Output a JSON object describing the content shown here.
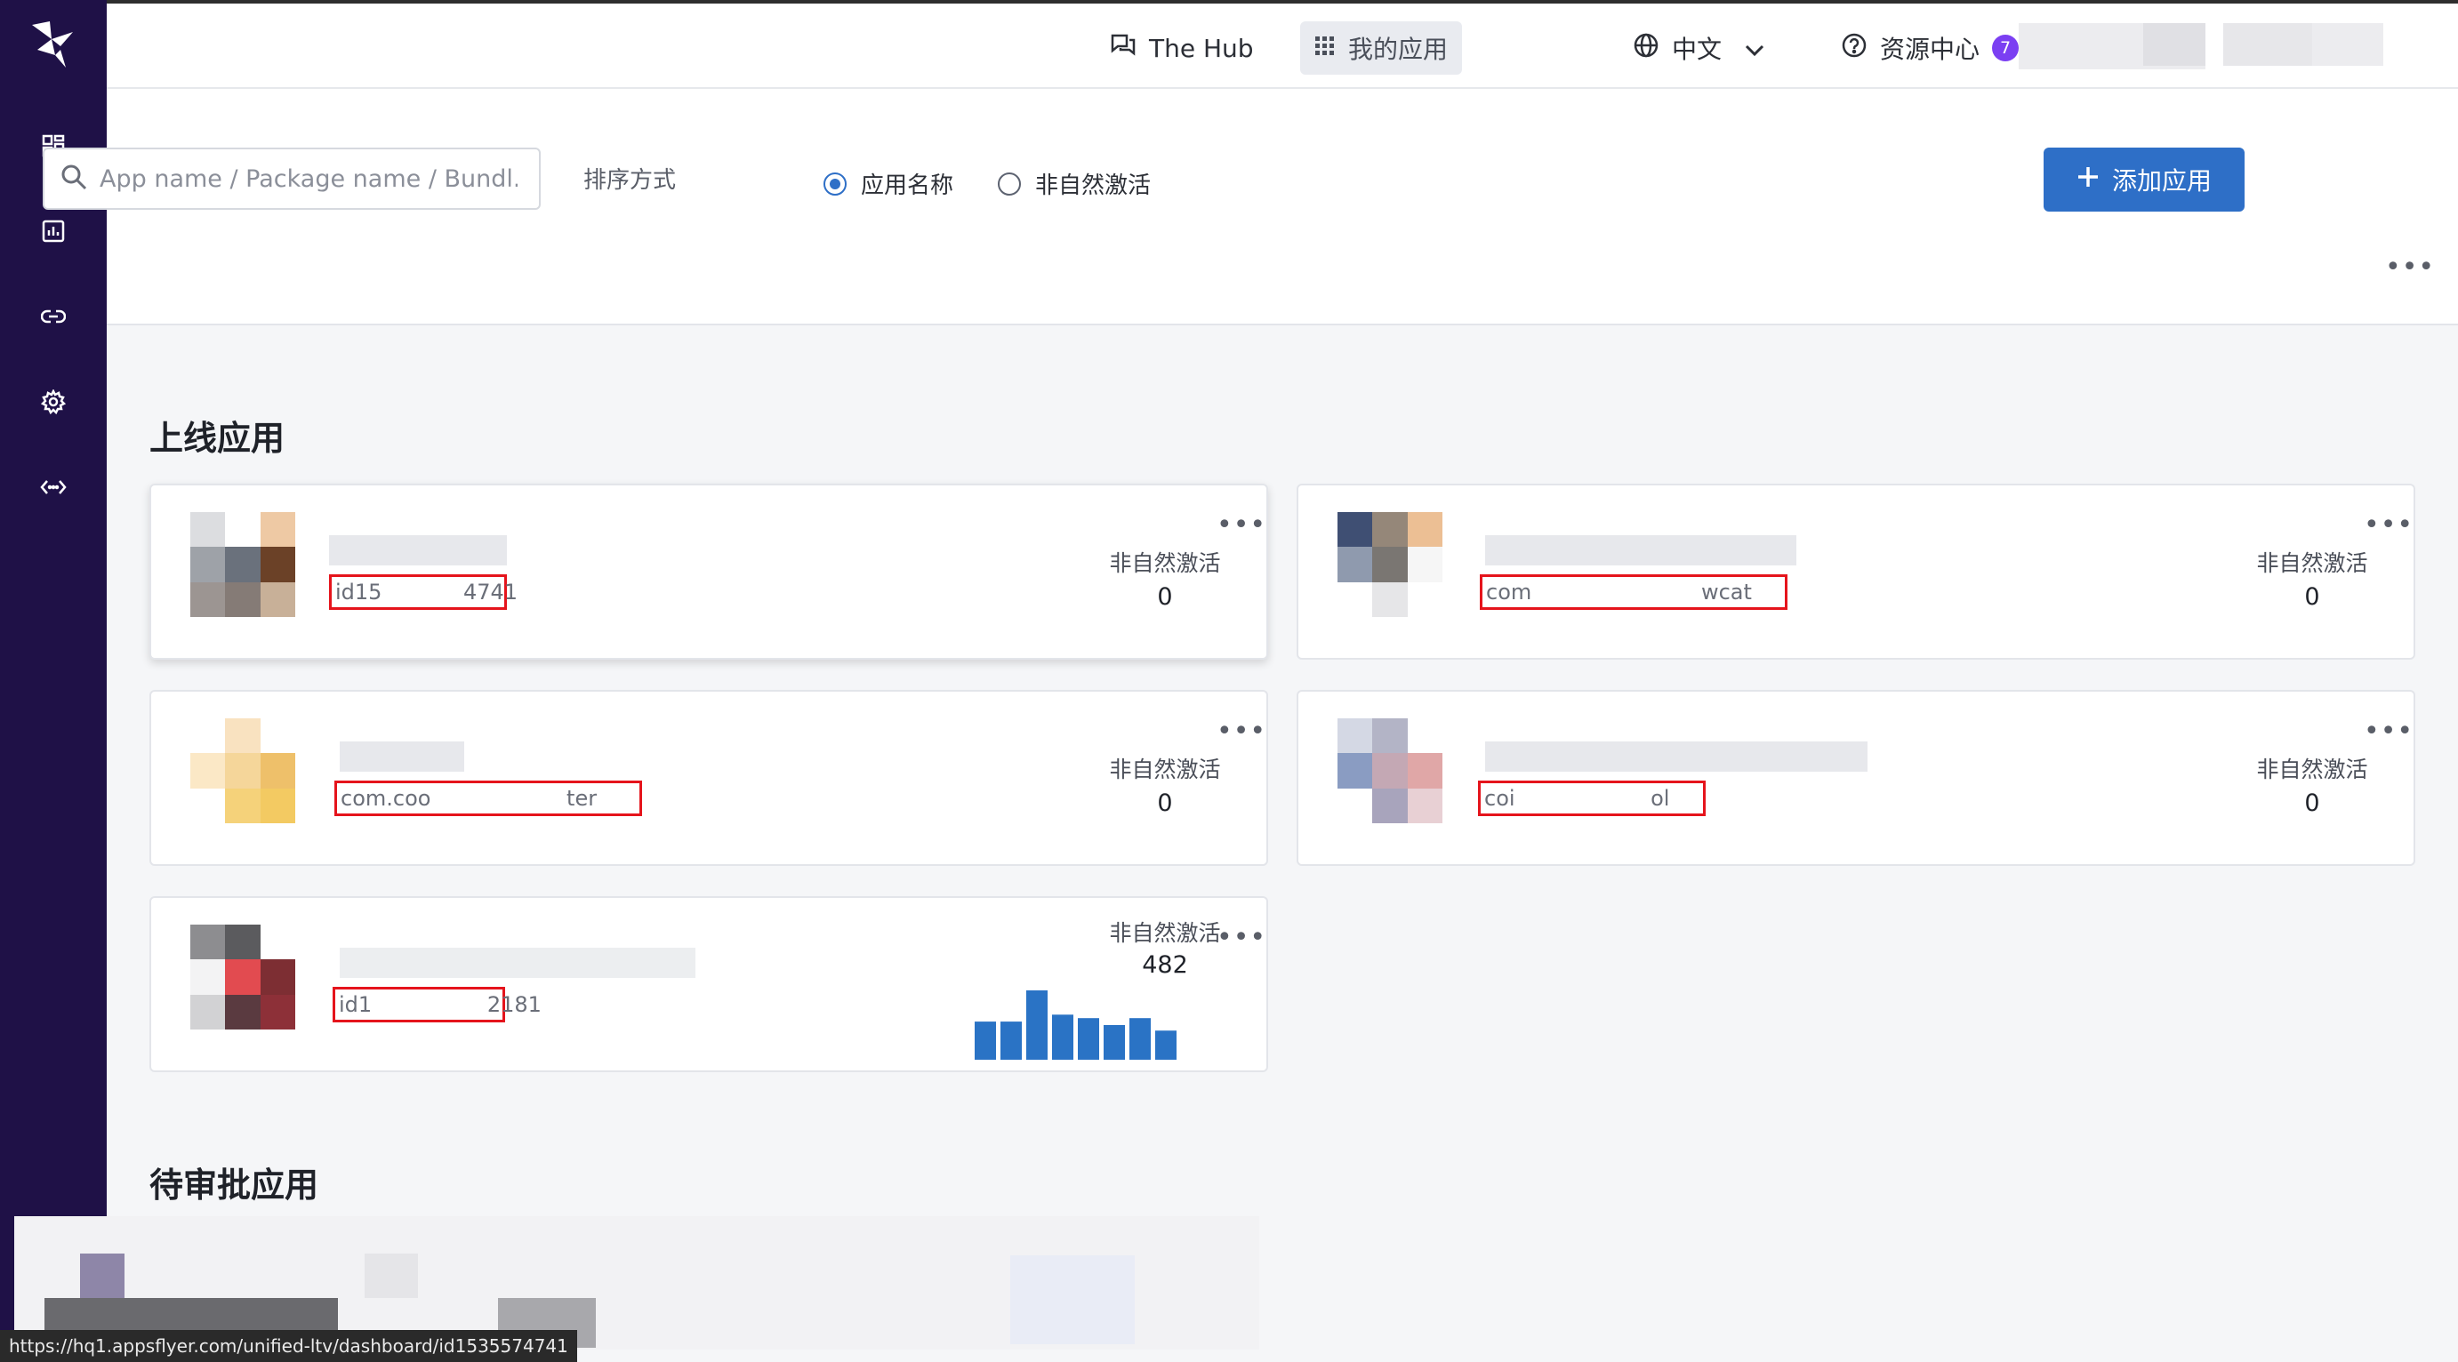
{
  "topbar": {
    "hub_label": "The Hub",
    "myapps_label": "我的应用",
    "lang_label": "中文",
    "resources_label": "资源中心",
    "resources_badge": "7"
  },
  "toolbar": {
    "search_placeholder": "App name / Package name / Bundl...",
    "sort_label": "排序方式",
    "sort_options": [
      "应用名称",
      "非自然激活"
    ],
    "sort_selected": "应用名称",
    "add_label": "添加应用"
  },
  "sections": {
    "live_title": "上线应用",
    "pending_title": "待审批应用"
  },
  "apps": [
    {
      "pkg": "id15            4741",
      "metric_label": "非自然激活",
      "metric_value": "0"
    },
    {
      "pkg": "com                         wcat",
      "metric_label": "非自然激活",
      "metric_value": "0"
    },
    {
      "pkg": "com.coo                    ter",
      "metric_label": "非自然激活",
      "metric_value": "0"
    },
    {
      "pkg": "coi                    ol",
      "metric_label": "非自然激活",
      "metric_value": "0"
    },
    {
      "pkg": "id1                 2181",
      "metric_label": "非自然激活",
      "metric_value": "482"
    }
  ],
  "mini_chart": {
    "values": [
      0.55,
      0.55,
      1.0,
      0.65,
      0.6,
      0.5,
      0.6,
      0.42
    ],
    "color": "#2a73c5"
  },
  "status_url": "https://hq1.appsflyer.com/unified-ltv/dashboard/id1535574741"
}
